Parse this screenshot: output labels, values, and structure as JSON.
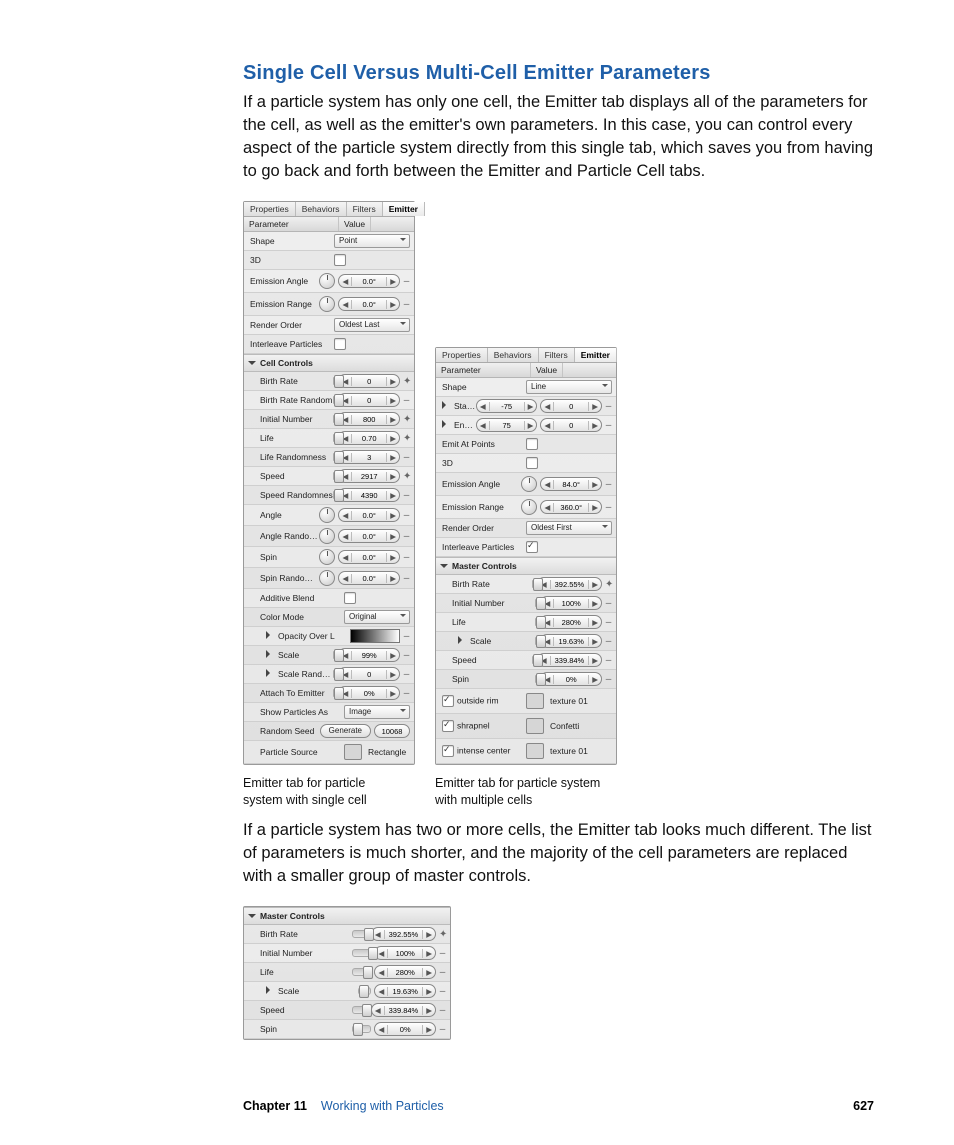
{
  "heading": "Single Cell Versus Multi-Cell Emitter Parameters",
  "p1": "If a particle system has only one cell, the Emitter tab displays all of the parameters for the cell, as well as the emitter's own parameters. In this case, you can control every aspect of the particle system directly from this single tab, which saves you from having to go back and forth between the Emitter and Particle Cell tabs.",
  "p2": "If a particle system has two or more cells, the Emitter tab looks much different. The list of parameters is much shorter, and the majority of the cell parameters are replaced with a smaller group of master controls.",
  "cap1": "Emitter tab for particle system with single cell",
  "cap2": "Emitter tab for particle system with multiple cells",
  "tabs": [
    "Properties",
    "Behaviors",
    "Filters",
    "Emitter"
  ],
  "cols": {
    "param": "Parameter",
    "value": "Value"
  },
  "left": {
    "shape": "Shape",
    "shape_v": "Point",
    "three_d": "3D",
    "ea": "Emission Angle",
    "ea_v": "0.0°",
    "er": "Emission Range",
    "er_v": "0.0°",
    "ro": "Render Order",
    "ro_v": "Oldest Last",
    "ip": "Interleave Particles",
    "cc": "Cell Controls",
    "br": "Birth Rate",
    "br_v": "0",
    "brr": "Birth Rate Random",
    "brr_v": "0",
    "in": "Initial Number",
    "in_v": "800",
    "life": "Life",
    "life_v": "0.70",
    "lr": "Life Randomness",
    "lr_v": "3",
    "sp": "Speed",
    "sp_v": "2917",
    "spr": "Speed Randomnes",
    "spr_v": "4390",
    "ang": "Angle",
    "ang_v": "0.0°",
    "angr": "Angle Randomnes",
    "angr_v": "0.0°",
    "spin": "Spin",
    "spin_v": "0.0°",
    "spinr": "Spin Randomness",
    "spinr_v": "0.0°",
    "ab": "Additive Blend",
    "cm": "Color Mode",
    "cm_v": "Original",
    "ool": "Opacity Over L",
    "sc": "Scale",
    "sc_v": "99%",
    "scr": "Scale Random",
    "scr_v": "0",
    "ate": "Attach To Emitter",
    "ate_v": "0%",
    "spa": "Show Particles As",
    "spa_v": "Image",
    "rs": "Random Seed",
    "rs_btn": "Generate",
    "rs_v": "10068",
    "ps": "Particle Source",
    "ps_v": "Rectangle"
  },
  "right": {
    "shape": "Shape",
    "shape_v": "Line",
    "spnt": "Start Point",
    "spnt_x": "-75",
    "spnt_y": "0",
    "epnt": "End Point",
    "epnt_x": "75",
    "epnt_y": "0",
    "eap": "Emit At Points",
    "three_d": "3D",
    "ea": "Emission Angle",
    "ea_v": "84.0°",
    "er": "Emission Range",
    "er_v": "360.0°",
    "ro": "Render Order",
    "ro_v": "Oldest First",
    "ip": "Interleave Particles",
    "mc": "Master Controls",
    "br": "Birth Rate",
    "br_v": "392.55%",
    "in": "Initial Number",
    "in_v": "100%",
    "life": "Life",
    "life_v": "280%",
    "sc": "Scale",
    "sc_v": "19.63%",
    "sp": "Speed",
    "sp_v": "339.84%",
    "spin": "Spin",
    "spin_v": "0%",
    "cells": [
      {
        "n": "outside rim",
        "s": "texture 01"
      },
      {
        "n": "shrapnel",
        "s": "Confetti"
      },
      {
        "n": "intense center",
        "s": "texture 01"
      }
    ]
  },
  "mc": {
    "title": "Master Controls",
    "br": "Birth Rate",
    "br_v": "392.55%",
    "in": "Initial Number",
    "in_v": "100%",
    "life": "Life",
    "life_v": "280%",
    "sc": "Scale",
    "sc_v": "19.63%",
    "sp": "Speed",
    "sp_v": "339.84%",
    "spin": "Spin",
    "spin_v": "0%"
  },
  "footer": {
    "chapter": "Chapter 11",
    "title": "Working with Particles",
    "page": "627"
  }
}
